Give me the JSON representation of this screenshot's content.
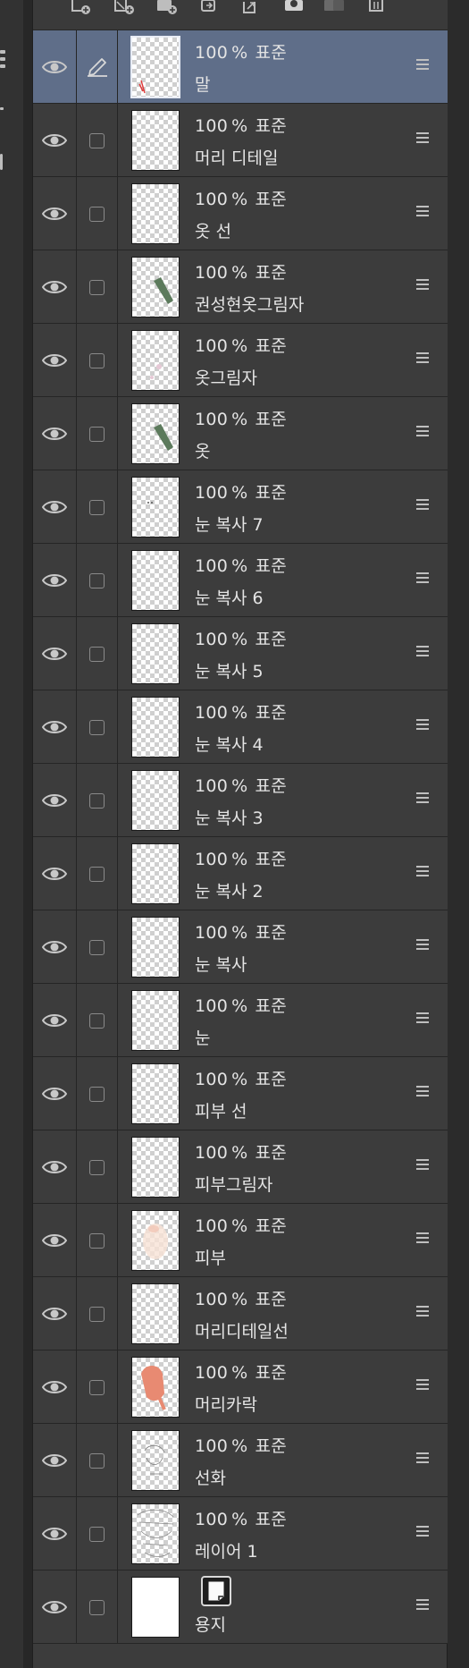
{
  "layers": [
    {
      "opacity": "100",
      "percent": "%",
      "blend": "표준",
      "name": "말",
      "selected": true,
      "pen": true,
      "thumb": "mal"
    },
    {
      "opacity": "100",
      "percent": "%",
      "blend": "표준",
      "name": "머리 디테일",
      "thumb": "blank"
    },
    {
      "opacity": "100",
      "percent": "%",
      "blend": "표준",
      "name": "옷 선",
      "thumb": "blank"
    },
    {
      "opacity": "100",
      "percent": "%",
      "blend": "표준",
      "name": "권성현옷그림자",
      "thumb": "green"
    },
    {
      "opacity": "100",
      "percent": "%",
      "blend": "표준",
      "name": "옷그림자",
      "thumb": "faint"
    },
    {
      "opacity": "100",
      "percent": "%",
      "blend": "표준",
      "name": "옷",
      "thumb": "green"
    },
    {
      "opacity": "100",
      "percent": "%",
      "blend": "표준",
      "name": "눈 복사 7",
      "thumb": "dots"
    },
    {
      "opacity": "100",
      "percent": "%",
      "blend": "표준",
      "name": "눈 복사 6",
      "thumb": "blank"
    },
    {
      "opacity": "100",
      "percent": "%",
      "blend": "표준",
      "name": "눈 복사 5",
      "thumb": "blank"
    },
    {
      "opacity": "100",
      "percent": "%",
      "blend": "표준",
      "name": "눈 복사 4",
      "thumb": "blank"
    },
    {
      "opacity": "100",
      "percent": "%",
      "blend": "표준",
      "name": "눈 복사 3",
      "thumb": "blank"
    },
    {
      "opacity": "100",
      "percent": "%",
      "blend": "표준",
      "name": "눈 복사 2",
      "thumb": "blank"
    },
    {
      "opacity": "100",
      "percent": "%",
      "blend": "표준",
      "name": "눈 복사",
      "thumb": "blank"
    },
    {
      "opacity": "100",
      "percent": "%",
      "blend": "표준",
      "name": "눈",
      "thumb": "blank"
    },
    {
      "opacity": "100",
      "percent": "%",
      "blend": "표준",
      "name": "피부 선",
      "thumb": "blank"
    },
    {
      "opacity": "100",
      "percent": "%",
      "blend": "표준",
      "name": "피부그림자",
      "thumb": "blank"
    },
    {
      "opacity": "100",
      "percent": "%",
      "blend": "표준",
      "name": "피부",
      "thumb": "skin"
    },
    {
      "opacity": "100",
      "percent": "%",
      "blend": "표준",
      "name": "머리디테일선",
      "thumb": "blank"
    },
    {
      "opacity": "100",
      "percent": "%",
      "blend": "표준",
      "name": "머리카락",
      "thumb": "hair"
    },
    {
      "opacity": "100",
      "percent": "%",
      "blend": "표준",
      "name": "선화",
      "thumb": "lineart"
    },
    {
      "opacity": "100",
      "percent": "%",
      "blend": "표준",
      "name": "레이어 1",
      "thumb": "sketch"
    },
    {
      "name": "용지",
      "paper": true,
      "thumb": "paper"
    }
  ],
  "toolbar": {
    "icons": [
      "new-raster-layer-icon",
      "new-vector-layer-icon",
      "new-folder-icon",
      "transfer-layer-icon",
      "merge-down-icon",
      "create-mask-icon",
      "apply-mask-icon",
      "delete-layer-icon"
    ]
  },
  "colors": {
    "selected_row": "#5f6e89",
    "panel": "#3c3c3c",
    "divider": "#252525"
  }
}
